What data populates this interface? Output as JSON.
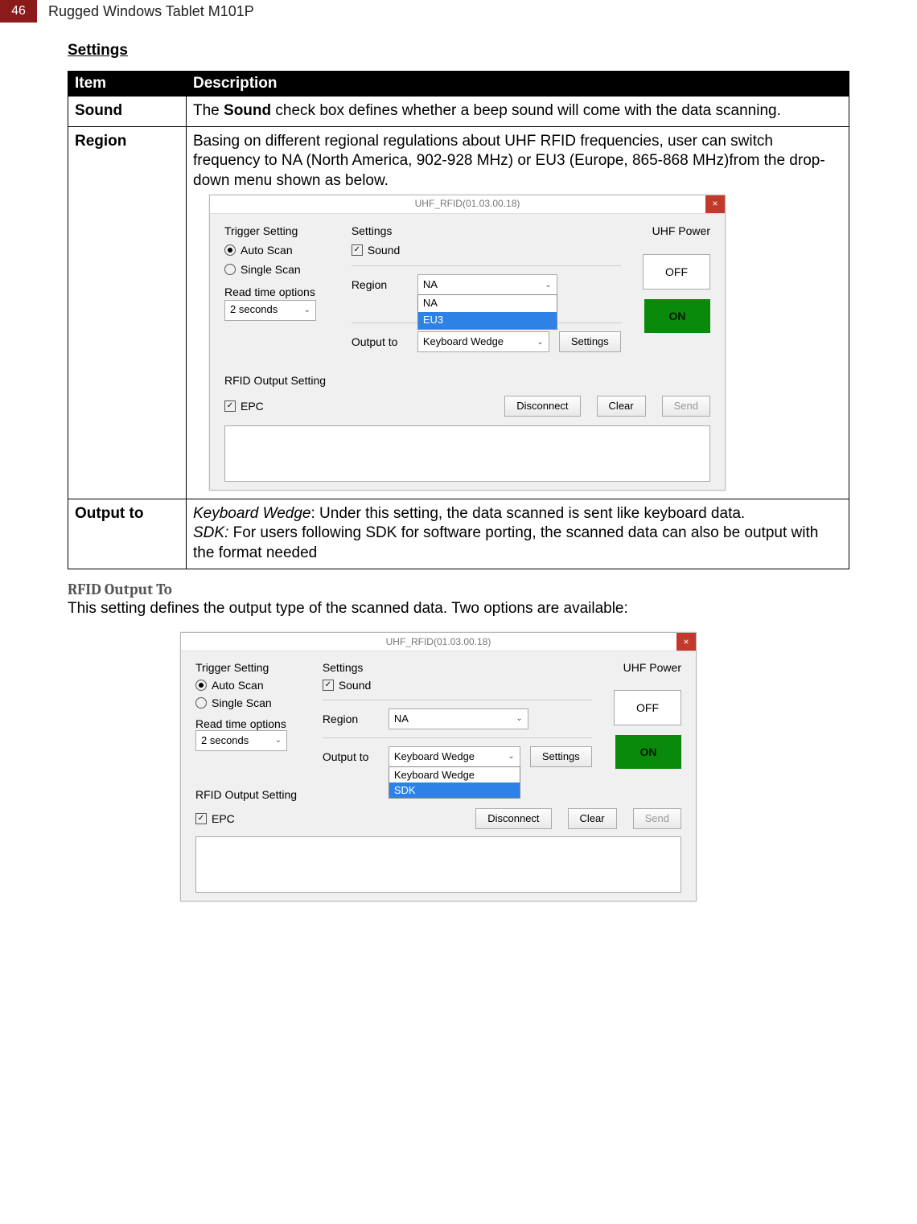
{
  "page": {
    "number": "46",
    "title": "Rugged Windows Tablet M101P"
  },
  "sections": {
    "settings_heading": "Settings",
    "table": {
      "headers": {
        "item": "Item",
        "description": "Description"
      },
      "rows": {
        "sound": {
          "item": "Sound",
          "desc_pre": "The ",
          "desc_bold": "Sound",
          "desc_post": " check box defines whether a beep sound will come with the data scanning."
        },
        "region": {
          "item": "Region",
          "desc": "Basing on different regional regulations about UHF RFID frequencies, user can switch frequency to NA (North America, 902-928 MHz) or EU3 (Europe, 865-868 MHz)from the drop-down menu shown as below."
        },
        "output_to": {
          "item": "Output to",
          "line1_italic": "Keyboard Wedge",
          "line1_rest": ": Under this setting, the data scanned is sent like keyboard data.",
          "line2_italic": "SDK:",
          "line2_rest": " For users following SDK for software porting, the scanned data can also be output with the format needed"
        }
      }
    },
    "rfid_output": {
      "title": "RFID Output To",
      "body": "This setting defines the output type of the scanned data. Two options are available:"
    }
  },
  "app": {
    "title": "UHF_RFID(01.03.00.18)",
    "close": "×",
    "trigger_setting": "Trigger Setting",
    "auto_scan": "Auto Scan",
    "single_scan": "Single Scan",
    "read_time_label": "Read time options",
    "read_time_value": "2 seconds",
    "settings_label": "Settings",
    "sound_label": "Sound",
    "region_label": "Region",
    "region_value": "NA",
    "region_options": {
      "na": "NA",
      "eu3": "EU3"
    },
    "output_to_label": "Output to",
    "output_to_value": "Keyboard Wedge",
    "output_options": {
      "kw": "Keyboard Wedge",
      "sdk": "SDK"
    },
    "settings_btn": "Settings",
    "uhf_power": "UHF Power",
    "off": "OFF",
    "on": "ON",
    "rfid_output_setting": "RFID Output Setting",
    "epc": "EPC",
    "disconnect": "Disconnect",
    "clear": "Clear",
    "send": "Send"
  }
}
